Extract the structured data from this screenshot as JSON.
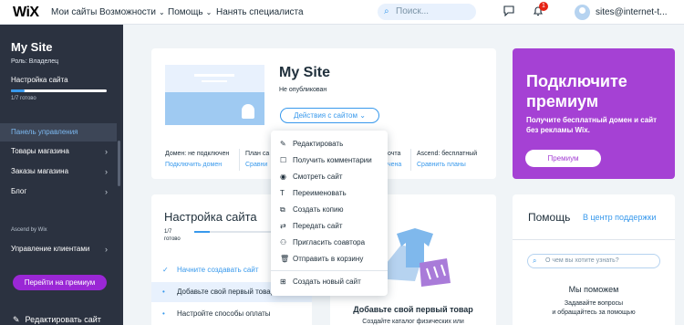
{
  "topbar": {
    "logo": "WiX",
    "nav": [
      "Мои сайты",
      "Возможности",
      "Помощь",
      "Нанять специалиста"
    ],
    "search_placeholder": "Поиск...",
    "notification_count": "1",
    "user": "sites@internet-t..."
  },
  "sidebar": {
    "title": "My Site",
    "role": "Роль: Владелец",
    "setup_label": "Настройка сайта",
    "progress_fraction": 0.143,
    "progress_text": "1/7 готово",
    "items": [
      "Панель управления",
      "Товары магазина",
      "Заказы магазина",
      "Блог"
    ],
    "section_label": "Ascend by Wix",
    "section_item": "Управление клиентами",
    "premium_button": "Перейти на премиум",
    "edit_site": "Редактировать сайт"
  },
  "site_card": {
    "name": "My Site",
    "status": "Не опубликован",
    "actions_button": "Действия с сайтом",
    "domain_label": "Домен: не подключен",
    "domain_link": "Подключить домен",
    "plan_label": "План са",
    "plan_link": "Сравни",
    "mail_label": "очта",
    "mail_link": "чена",
    "ascend_label": "Ascend: бесплатный",
    "ascend_link": "Сравнить планы"
  },
  "premium_card": {
    "heading_line1": "Подключите",
    "heading_line2": "премиум",
    "text": "Получите бесплатный домен и сайт без рекламы Wix.",
    "button": "Премиум",
    "bg_color": "#a541d4"
  },
  "setup_card": {
    "heading": "Настройка сайта",
    "count": "1/7",
    "count_label": "готово",
    "progress_fraction": 0.143,
    "steps": [
      "Начните создавать сайт",
      "Добавьте свой первый товар",
      "Настройте способы оплаты"
    ]
  },
  "product_card": {
    "title": "Добавьте свой первый товар",
    "subtitle": "Создайте каталог физических или"
  },
  "help_card": {
    "heading": "Помощь",
    "link": "В центр поддержки",
    "search_placeholder": "О чем вы хотите узнать?",
    "title": "Мы поможем",
    "text_line1": "Задавайте вопросы",
    "text_line2": "и обращайтесь за помощью"
  },
  "dropdown": {
    "items": [
      {
        "label": "Редактировать",
        "icon": "pencil-icon"
      },
      {
        "label": "Получить комментарии",
        "icon": "comment-icon"
      },
      {
        "label": "Смотреть сайт",
        "icon": "eye-icon"
      },
      {
        "label": "Переименовать",
        "icon": "text-icon"
      },
      {
        "label": "Создать копию",
        "icon": "copy-icon"
      },
      {
        "label": "Передать сайт",
        "icon": "transfer-icon"
      },
      {
        "label": "Пригласить соавтора",
        "icon": "invite-icon"
      },
      {
        "label": "Отправить в корзину",
        "icon": "trash-icon"
      },
      {
        "label": "Создать новый сайт",
        "icon": "new-site-icon"
      }
    ]
  },
  "colors": {
    "accent": "#3899ec",
    "sidebar_bg": "#2b3240",
    "premium_purple": "#9a27d5"
  }
}
